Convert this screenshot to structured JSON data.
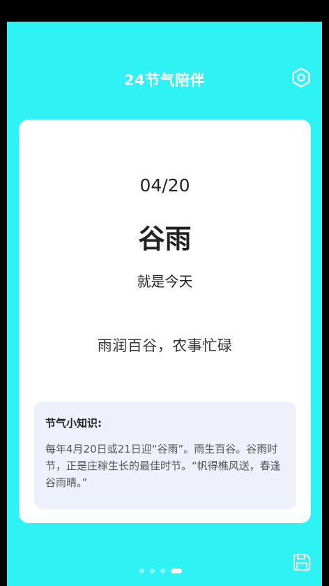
{
  "header": {
    "title": "24节气陪伴",
    "settings_icon": "gear-icon"
  },
  "card": {
    "date": "04/20",
    "term_name": "谷雨",
    "today_text": "就是今天",
    "proverb": "雨润百谷，农事忙碌",
    "knowledge": {
      "title": "节气小知识:",
      "text": "每年4月20日或21日迎“谷雨”。雨生百谷。谷雨时节，正是庄稼生长的最佳时节。“帆得樵风送，春逢谷雨晴。”"
    }
  },
  "pager": {
    "count": 4,
    "active_index": 3
  },
  "footer": {
    "save_icon": "save-icon"
  },
  "colors": {
    "background": "#2ff2f4",
    "card": "#ffffff",
    "knowledge_box": "#eef1fc"
  }
}
